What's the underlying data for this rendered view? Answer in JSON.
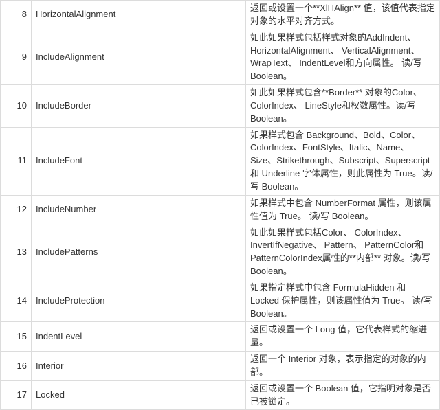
{
  "rows": [
    {
      "num": "8",
      "name": "HorizontalAlignment",
      "desc": "返回或设置一个**XlHAlign** 值，该值代表指定对象的水平对齐方式。"
    },
    {
      "num": "9",
      "name": "IncludeAlignment",
      "desc": "如此如果样式包括样式对象的AddIndent、 HorizontalAlignment、 VerticalAlignment、 WrapText、 IndentLevel和方向属性。 读/写 Boolean。"
    },
    {
      "num": "10",
      "name": "IncludeBorder",
      "desc": "如此如果样式包含**Border** 对象的Color、 ColorIndex、 LineStyle和权数属性。读/写 Boolean。"
    },
    {
      "num": "11",
      "name": "IncludeFont",
      "desc": "如果样式包含 Background、Bold、Color、ColorIndex、FontStyle、Italic、Name、Size、Strikethrough、Subscript、Superscript 和 Underline 字体属性，则此属性为 True。读/写 Boolean。"
    },
    {
      "num": "12",
      "name": "IncludeNumber",
      "desc": "如果样式中包含 NumberFormat 属性，则该属性值为 True。 读/写 Boolean。"
    },
    {
      "num": "13",
      "name": "IncludePatterns",
      "desc": "如此如果样式包括Color、 ColorIndex、 InvertIfNegative、 Pattern、 PatternColor和PatternColorIndex属性的**内部** 对象。读/写 Boolean。"
    },
    {
      "num": "14",
      "name": "IncludeProtection",
      "desc": "如果指定样式中包含 FormulaHidden 和 Locked 保护属性，则该属性值为 True。 读/写 Boolean。"
    },
    {
      "num": "15",
      "name": "IndentLevel",
      "desc": "返回或设置一个 Long 值，它代表样式的缩进量。"
    },
    {
      "num": "16",
      "name": "Interior",
      "desc": "返回一个 Interior 对象，表示指定的对象的内部。"
    },
    {
      "num": "17",
      "name": "Locked",
      "desc": "返回或设置一个 Boolean 值，它指明对象是否已被锁定。"
    }
  ]
}
